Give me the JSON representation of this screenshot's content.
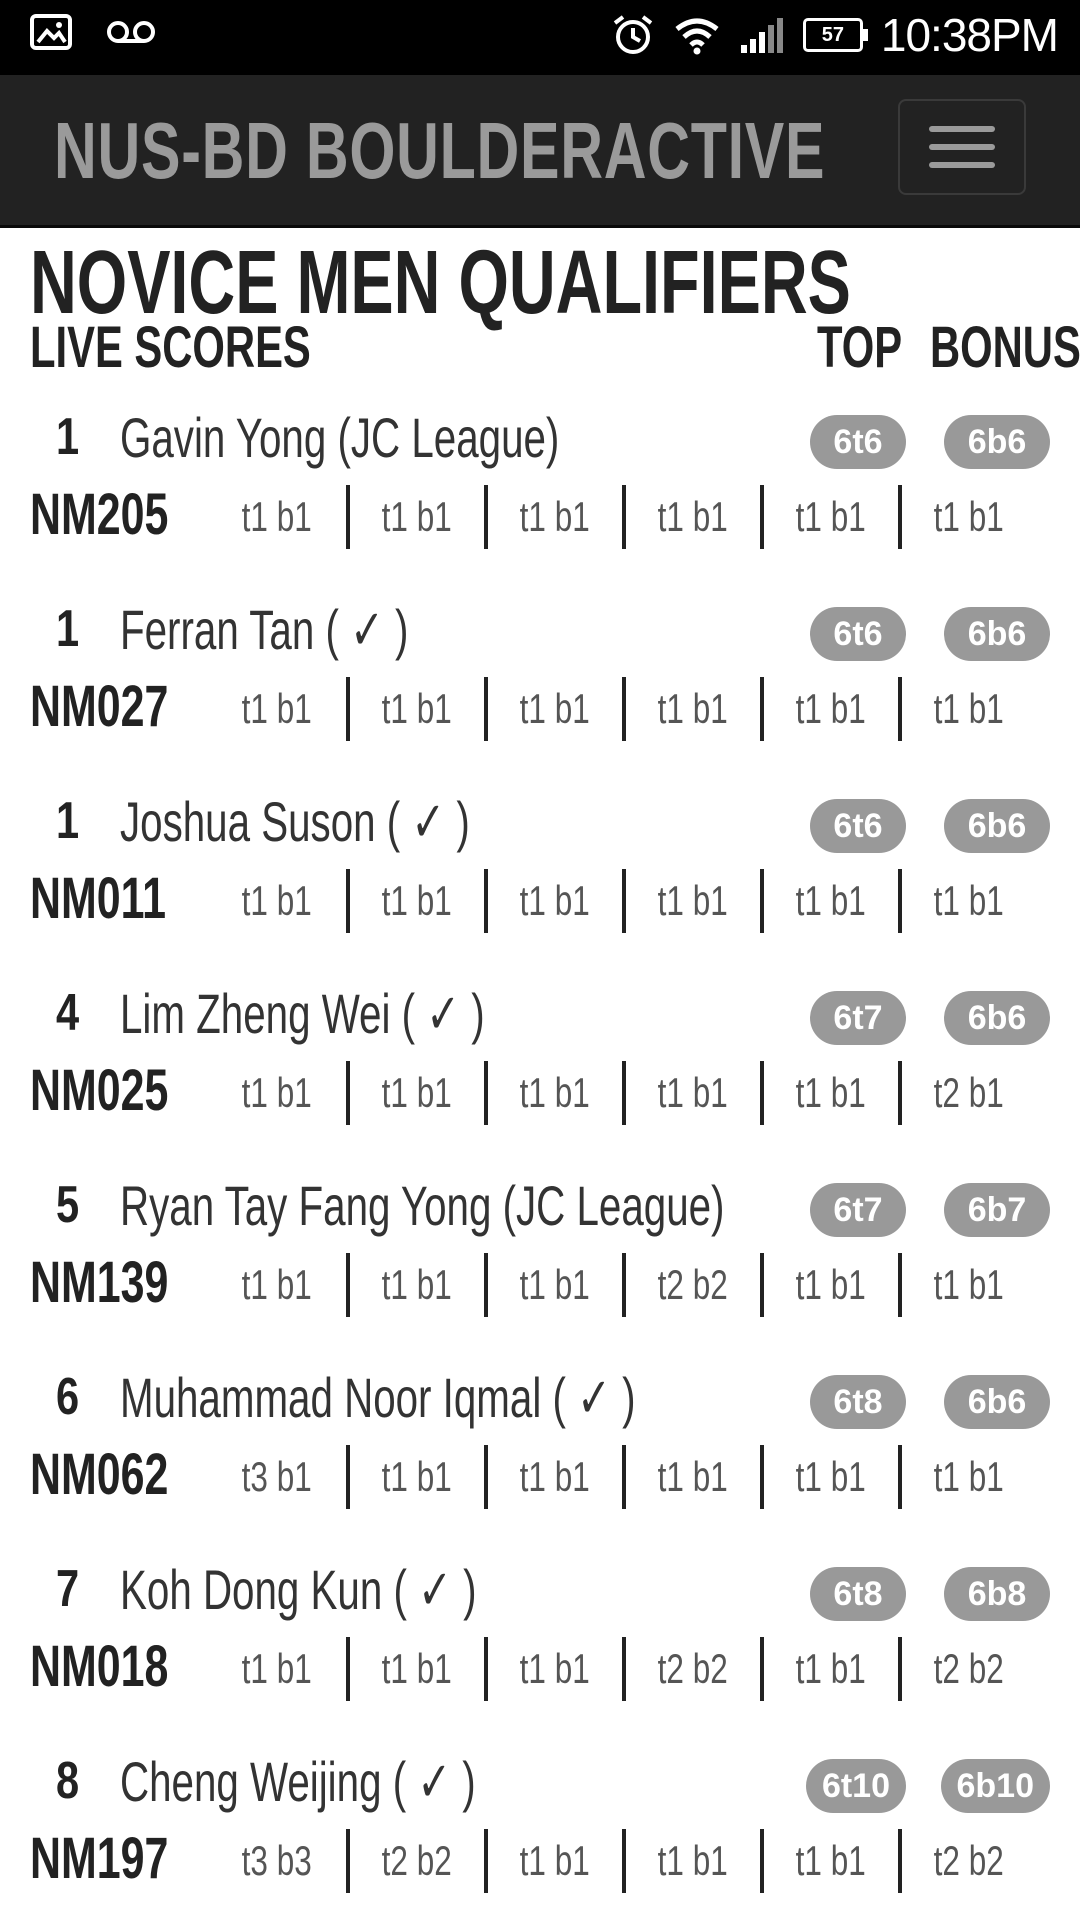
{
  "status_bar": {
    "time": "10:38PM",
    "battery": "57"
  },
  "navbar": {
    "brand": "NUS-BD BOULDERACTIVE"
  },
  "page": {
    "title": "NOVICE MEN QUALIFIERS",
    "live_scores": "LIVE SCORES",
    "top_header": "TOP",
    "bonus_header": "BONUS"
  },
  "entries": [
    {
      "rank": "1",
      "name": "Gavin Yong (JC League)",
      "code": "NM205",
      "top": "6t6",
      "bonus": "6b6",
      "attempts": [
        "t1 b1",
        "t1 b1",
        "t1 b1",
        "t1 b1",
        "t1 b1",
        "t1 b1"
      ]
    },
    {
      "rank": "1",
      "name": "Ferran Tan ( ✓ )",
      "code": "NM027",
      "top": "6t6",
      "bonus": "6b6",
      "attempts": [
        "t1 b1",
        "t1 b1",
        "t1 b1",
        "t1 b1",
        "t1 b1",
        "t1 b1"
      ]
    },
    {
      "rank": "1",
      "name": "Joshua Suson ( ✓ )",
      "code": "NM011",
      "top": "6t6",
      "bonus": "6b6",
      "attempts": [
        "t1 b1",
        "t1 b1",
        "t1 b1",
        "t1 b1",
        "t1 b1",
        "t1 b1"
      ]
    },
    {
      "rank": "4",
      "name": "Lim Zheng Wei ( ✓ )",
      "code": "NM025",
      "top": "6t7",
      "bonus": "6b6",
      "attempts": [
        "t1 b1",
        "t1 b1",
        "t1 b1",
        "t1 b1",
        "t1 b1",
        "t2 b1"
      ]
    },
    {
      "rank": "5",
      "name": "Ryan Tay Fang Yong (JC League)",
      "code": "NM139",
      "top": "6t7",
      "bonus": "6b7",
      "attempts": [
        "t1 b1",
        "t1 b1",
        "t1 b1",
        "t2 b2",
        "t1 b1",
        "t1 b1"
      ]
    },
    {
      "rank": "6",
      "name": "Muhammad Noor Iqmal ( ✓ )",
      "code": "NM062",
      "top": "6t8",
      "bonus": "6b6",
      "attempts": [
        "t3 b1",
        "t1 b1",
        "t1 b1",
        "t1 b1",
        "t1 b1",
        "t1 b1"
      ]
    },
    {
      "rank": "7",
      "name": "Koh Dong Kun ( ✓ )",
      "code": "NM018",
      "top": "6t8",
      "bonus": "6b8",
      "attempts": [
        "t1 b1",
        "t1 b1",
        "t1 b1",
        "t2 b2",
        "t1 b1",
        "t2 b2"
      ]
    },
    {
      "rank": "8",
      "name": "Cheng Weijing ( ✓ )",
      "code": "NM197",
      "top": "6t10",
      "bonus": "6b10",
      "attempts": [
        "t3 b3",
        "t2 b2",
        "t1 b1",
        "t1 b1",
        "t1 b1",
        "t2 b2"
      ]
    }
  ]
}
